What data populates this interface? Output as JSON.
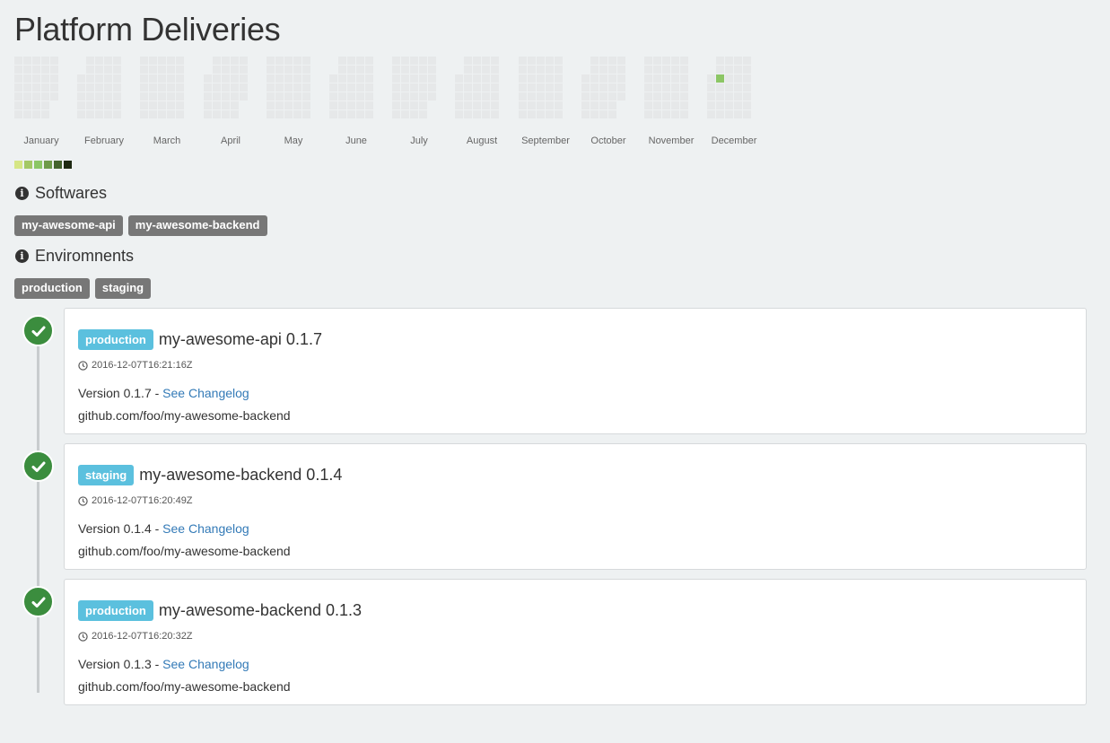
{
  "page": {
    "title": "Platform Deliveries"
  },
  "heatmap": {
    "months": [
      "January",
      "February",
      "March",
      "April",
      "May",
      "June",
      "July",
      "August",
      "September",
      "October",
      "November",
      "December"
    ],
    "empty_color": "#e6e8e9",
    "legend_colors": [
      "#d6e685",
      "#a4c865",
      "#8cc665",
      "#6e9a49",
      "#44632d",
      "#1e2a12"
    ],
    "highlighted_day": {
      "month": "December",
      "count": 1,
      "color": "#8cc665"
    }
  },
  "softwares": {
    "heading": "Softwares",
    "tags": [
      "my-awesome-api",
      "my-awesome-backend"
    ]
  },
  "environments": {
    "heading": "Enviromnents",
    "tags": [
      "production",
      "staging"
    ]
  },
  "deliveries": [
    {
      "env": "production",
      "title": "my-awesome-api 0.1.7",
      "timestamp": "2016-12-07T16:21:16Z",
      "version_text": "Version 0.1.7 - ",
      "changelog_label": "See Changelog",
      "repo": "github.com/foo/my-awesome-backend",
      "status": "success"
    },
    {
      "env": "staging",
      "title": "my-awesome-backend 0.1.4",
      "timestamp": "2016-12-07T16:20:49Z",
      "version_text": "Version 0.1.4 - ",
      "changelog_label": "See Changelog",
      "repo": "github.com/foo/my-awesome-backend",
      "status": "success"
    },
    {
      "env": "production",
      "title": "my-awesome-backend 0.1.3",
      "timestamp": "2016-12-07T16:20:32Z",
      "version_text": "Version 0.1.3 - ",
      "changelog_label": "See Changelog",
      "repo": "github.com/foo/my-awesome-backend",
      "status": "success"
    }
  ],
  "colors": {
    "success": "#3b8d3e",
    "env_label": "#5bc0de",
    "tag": "#777777",
    "link": "#337ab7"
  }
}
